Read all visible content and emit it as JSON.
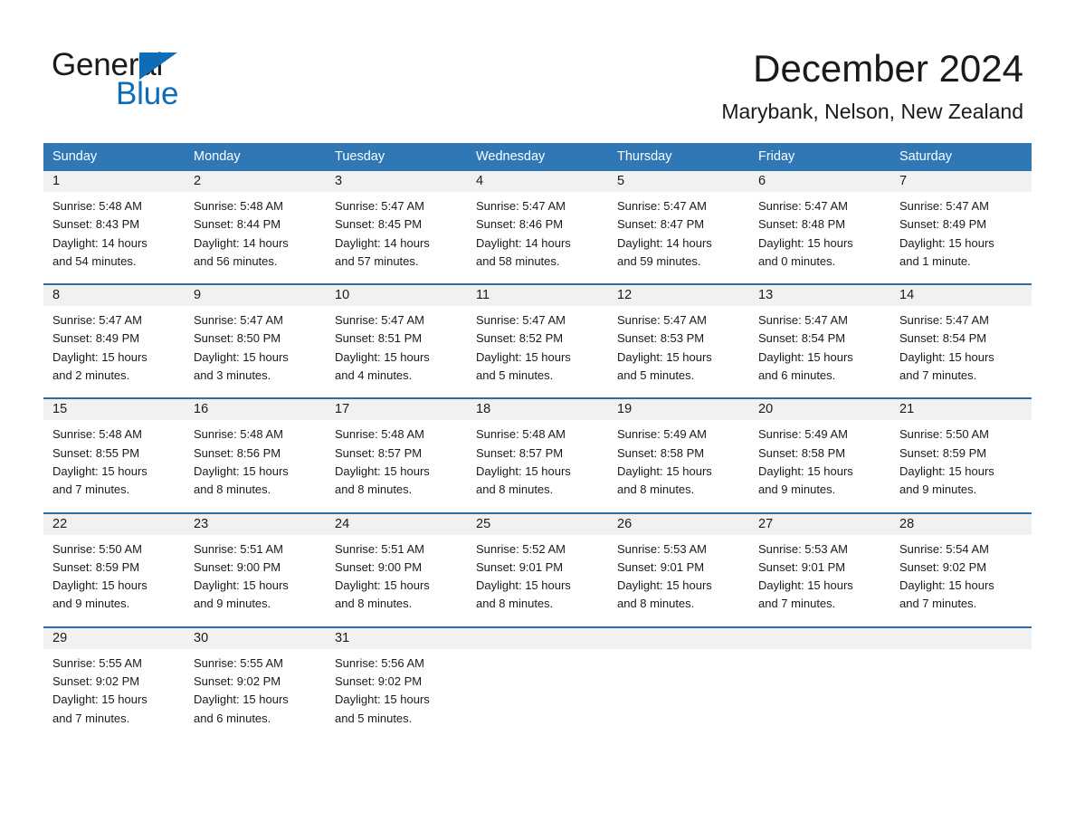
{
  "logo": {
    "word_one": "General",
    "word_two": "Blue",
    "triangle_color": "#0f6cb6",
    "text_color": "#1a1a1a"
  },
  "header": {
    "title": "December 2024",
    "subtitle": "Marybank, Nelson, New Zealand"
  },
  "theme": {
    "header_blue": "#3077b5",
    "row_rule_blue": "#2d6ca8",
    "daynum_band": "#f1f1f1",
    "page_background": "#ffffff",
    "text": "#1a1a1a"
  },
  "weekdays": [
    "Sunday",
    "Monday",
    "Tuesday",
    "Wednesday",
    "Thursday",
    "Friday",
    "Saturday"
  ],
  "weeks": [
    [
      {
        "day": "1",
        "sunrise": "Sunrise: 5:48 AM",
        "sunset": "Sunset: 8:43 PM",
        "daylight_1": "Daylight: 14 hours",
        "daylight_2": "and 54 minutes."
      },
      {
        "day": "2",
        "sunrise": "Sunrise: 5:48 AM",
        "sunset": "Sunset: 8:44 PM",
        "daylight_1": "Daylight: 14 hours",
        "daylight_2": "and 56 minutes."
      },
      {
        "day": "3",
        "sunrise": "Sunrise: 5:47 AM",
        "sunset": "Sunset: 8:45 PM",
        "daylight_1": "Daylight: 14 hours",
        "daylight_2": "and 57 minutes."
      },
      {
        "day": "4",
        "sunrise": "Sunrise: 5:47 AM",
        "sunset": "Sunset: 8:46 PM",
        "daylight_1": "Daylight: 14 hours",
        "daylight_2": "and 58 minutes."
      },
      {
        "day": "5",
        "sunrise": "Sunrise: 5:47 AM",
        "sunset": "Sunset: 8:47 PM",
        "daylight_1": "Daylight: 14 hours",
        "daylight_2": "and 59 minutes."
      },
      {
        "day": "6",
        "sunrise": "Sunrise: 5:47 AM",
        "sunset": "Sunset: 8:48 PM",
        "daylight_1": "Daylight: 15 hours",
        "daylight_2": "and 0 minutes."
      },
      {
        "day": "7",
        "sunrise": "Sunrise: 5:47 AM",
        "sunset": "Sunset: 8:49 PM",
        "daylight_1": "Daylight: 15 hours",
        "daylight_2": "and 1 minute."
      }
    ],
    [
      {
        "day": "8",
        "sunrise": "Sunrise: 5:47 AM",
        "sunset": "Sunset: 8:49 PM",
        "daylight_1": "Daylight: 15 hours",
        "daylight_2": "and 2 minutes."
      },
      {
        "day": "9",
        "sunrise": "Sunrise: 5:47 AM",
        "sunset": "Sunset: 8:50 PM",
        "daylight_1": "Daylight: 15 hours",
        "daylight_2": "and 3 minutes."
      },
      {
        "day": "10",
        "sunrise": "Sunrise: 5:47 AM",
        "sunset": "Sunset: 8:51 PM",
        "daylight_1": "Daylight: 15 hours",
        "daylight_2": "and 4 minutes."
      },
      {
        "day": "11",
        "sunrise": "Sunrise: 5:47 AM",
        "sunset": "Sunset: 8:52 PM",
        "daylight_1": "Daylight: 15 hours",
        "daylight_2": "and 5 minutes."
      },
      {
        "day": "12",
        "sunrise": "Sunrise: 5:47 AM",
        "sunset": "Sunset: 8:53 PM",
        "daylight_1": "Daylight: 15 hours",
        "daylight_2": "and 5 minutes."
      },
      {
        "day": "13",
        "sunrise": "Sunrise: 5:47 AM",
        "sunset": "Sunset: 8:54 PM",
        "daylight_1": "Daylight: 15 hours",
        "daylight_2": "and 6 minutes."
      },
      {
        "day": "14",
        "sunrise": "Sunrise: 5:47 AM",
        "sunset": "Sunset: 8:54 PM",
        "daylight_1": "Daylight: 15 hours",
        "daylight_2": "and 7 minutes."
      }
    ],
    [
      {
        "day": "15",
        "sunrise": "Sunrise: 5:48 AM",
        "sunset": "Sunset: 8:55 PM",
        "daylight_1": "Daylight: 15 hours",
        "daylight_2": "and 7 minutes."
      },
      {
        "day": "16",
        "sunrise": "Sunrise: 5:48 AM",
        "sunset": "Sunset: 8:56 PM",
        "daylight_1": "Daylight: 15 hours",
        "daylight_2": "and 8 minutes."
      },
      {
        "day": "17",
        "sunrise": "Sunrise: 5:48 AM",
        "sunset": "Sunset: 8:57 PM",
        "daylight_1": "Daylight: 15 hours",
        "daylight_2": "and 8 minutes."
      },
      {
        "day": "18",
        "sunrise": "Sunrise: 5:48 AM",
        "sunset": "Sunset: 8:57 PM",
        "daylight_1": "Daylight: 15 hours",
        "daylight_2": "and 8 minutes."
      },
      {
        "day": "19",
        "sunrise": "Sunrise: 5:49 AM",
        "sunset": "Sunset: 8:58 PM",
        "daylight_1": "Daylight: 15 hours",
        "daylight_2": "and 8 minutes."
      },
      {
        "day": "20",
        "sunrise": "Sunrise: 5:49 AM",
        "sunset": "Sunset: 8:58 PM",
        "daylight_1": "Daylight: 15 hours",
        "daylight_2": "and 9 minutes."
      },
      {
        "day": "21",
        "sunrise": "Sunrise: 5:50 AM",
        "sunset": "Sunset: 8:59 PM",
        "daylight_1": "Daylight: 15 hours",
        "daylight_2": "and 9 minutes."
      }
    ],
    [
      {
        "day": "22",
        "sunrise": "Sunrise: 5:50 AM",
        "sunset": "Sunset: 8:59 PM",
        "daylight_1": "Daylight: 15 hours",
        "daylight_2": "and 9 minutes."
      },
      {
        "day": "23",
        "sunrise": "Sunrise: 5:51 AM",
        "sunset": "Sunset: 9:00 PM",
        "daylight_1": "Daylight: 15 hours",
        "daylight_2": "and 9 minutes."
      },
      {
        "day": "24",
        "sunrise": "Sunrise: 5:51 AM",
        "sunset": "Sunset: 9:00 PM",
        "daylight_1": "Daylight: 15 hours",
        "daylight_2": "and 8 minutes."
      },
      {
        "day": "25",
        "sunrise": "Sunrise: 5:52 AM",
        "sunset": "Sunset: 9:01 PM",
        "daylight_1": "Daylight: 15 hours",
        "daylight_2": "and 8 minutes."
      },
      {
        "day": "26",
        "sunrise": "Sunrise: 5:53 AM",
        "sunset": "Sunset: 9:01 PM",
        "daylight_1": "Daylight: 15 hours",
        "daylight_2": "and 8 minutes."
      },
      {
        "day": "27",
        "sunrise": "Sunrise: 5:53 AM",
        "sunset": "Sunset: 9:01 PM",
        "daylight_1": "Daylight: 15 hours",
        "daylight_2": "and 7 minutes."
      },
      {
        "day": "28",
        "sunrise": "Sunrise: 5:54 AM",
        "sunset": "Sunset: 9:02 PM",
        "daylight_1": "Daylight: 15 hours",
        "daylight_2": "and 7 minutes."
      }
    ],
    [
      {
        "day": "29",
        "sunrise": "Sunrise: 5:55 AM",
        "sunset": "Sunset: 9:02 PM",
        "daylight_1": "Daylight: 15 hours",
        "daylight_2": "and 7 minutes."
      },
      {
        "day": "30",
        "sunrise": "Sunrise: 5:55 AM",
        "sunset": "Sunset: 9:02 PM",
        "daylight_1": "Daylight: 15 hours",
        "daylight_2": "and 6 minutes."
      },
      {
        "day": "31",
        "sunrise": "Sunrise: 5:56 AM",
        "sunset": "Sunset: 9:02 PM",
        "daylight_1": "Daylight: 15 hours",
        "daylight_2": "and 5 minutes."
      },
      {
        "day": "",
        "sunrise": "",
        "sunset": "",
        "daylight_1": "",
        "daylight_2": ""
      },
      {
        "day": "",
        "sunrise": "",
        "sunset": "",
        "daylight_1": "",
        "daylight_2": ""
      },
      {
        "day": "",
        "sunrise": "",
        "sunset": "",
        "daylight_1": "",
        "daylight_2": ""
      },
      {
        "day": "",
        "sunrise": "",
        "sunset": "",
        "daylight_1": "",
        "daylight_2": ""
      }
    ]
  ]
}
